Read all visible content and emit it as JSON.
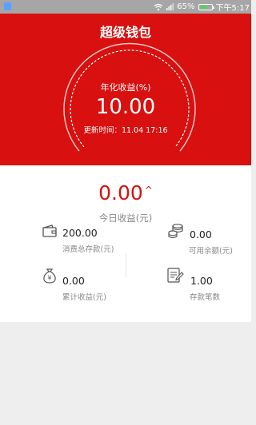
{
  "status_bar": {
    "battery_percent": "65%",
    "battery_level": 0.65,
    "time": "下午5:17",
    "icons": [
      "app-notification-icon",
      "wifi-icon",
      "signal-icon",
      "battery-icon"
    ]
  },
  "header": {
    "title": "超级钱包",
    "yield_label": "年化收益(%)",
    "yield_value": "10.00",
    "update_label": "更新时间：",
    "update_time": "11.04 17:16",
    "color": "#d81010"
  },
  "today": {
    "amount": "0.00",
    "caret": "^",
    "label": "今日收益(元)"
  },
  "stats": {
    "total_deposit": {
      "value": "200.00",
      "label": "消费总存款(元)",
      "icon": "wallet-icon"
    },
    "balance": {
      "value": "0.00",
      "label": "可用余额(元)",
      "icon": "coins-icon"
    },
    "cumulative_income": {
      "value": "0.00",
      "label": "累计收益(元)",
      "icon": "money-bag-icon"
    },
    "deposit_count": {
      "value": "1.00",
      "label": "存款笔数",
      "icon": "document-edit-icon"
    }
  }
}
